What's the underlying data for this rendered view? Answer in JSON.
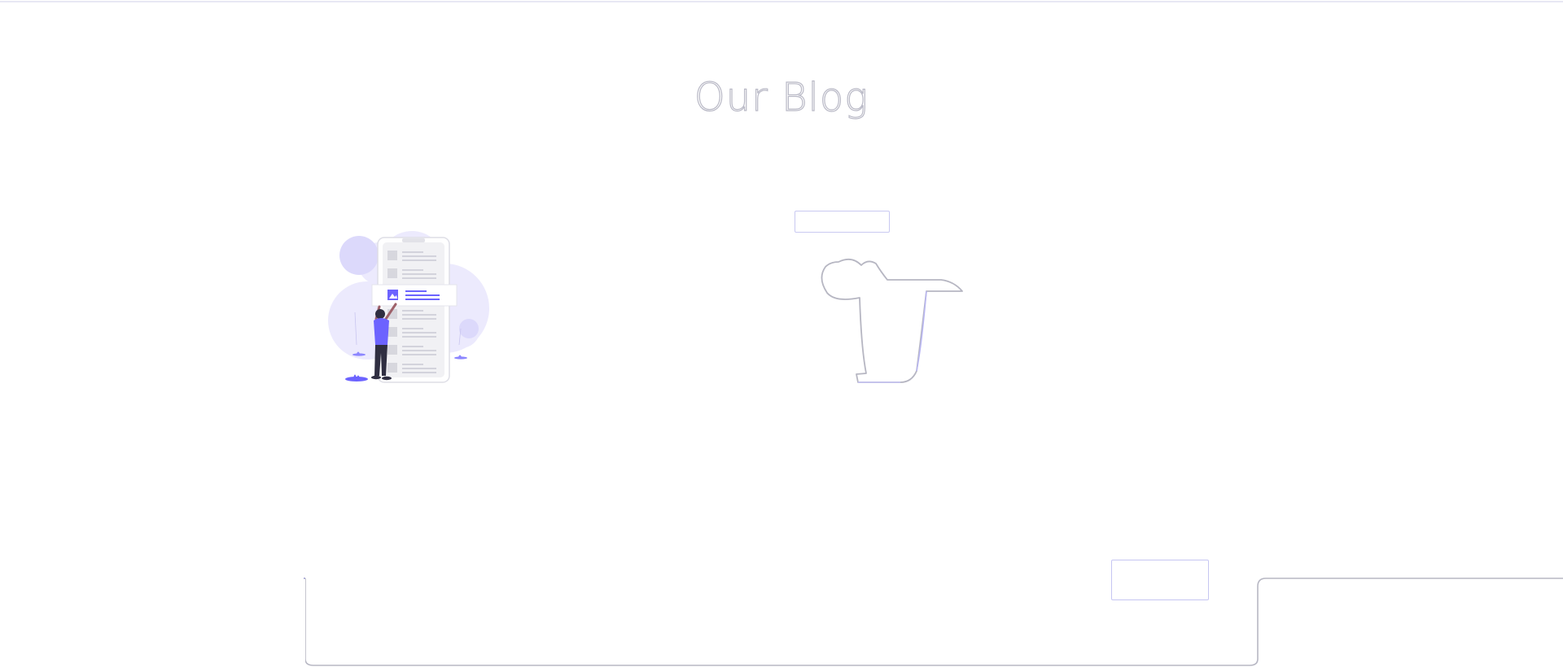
{
  "page": {
    "title": "Our Blog"
  },
  "colors": {
    "accent": "#6c63ff",
    "accent_light": "#e6e6ff",
    "outline": "#c9c9f1",
    "line_gray": "#d3d3dc",
    "figure_dark": "#2f2e41"
  },
  "icons": {
    "hero": "person-with-phone-feed-illustration",
    "cup": "cup-outline-graphic"
  }
}
